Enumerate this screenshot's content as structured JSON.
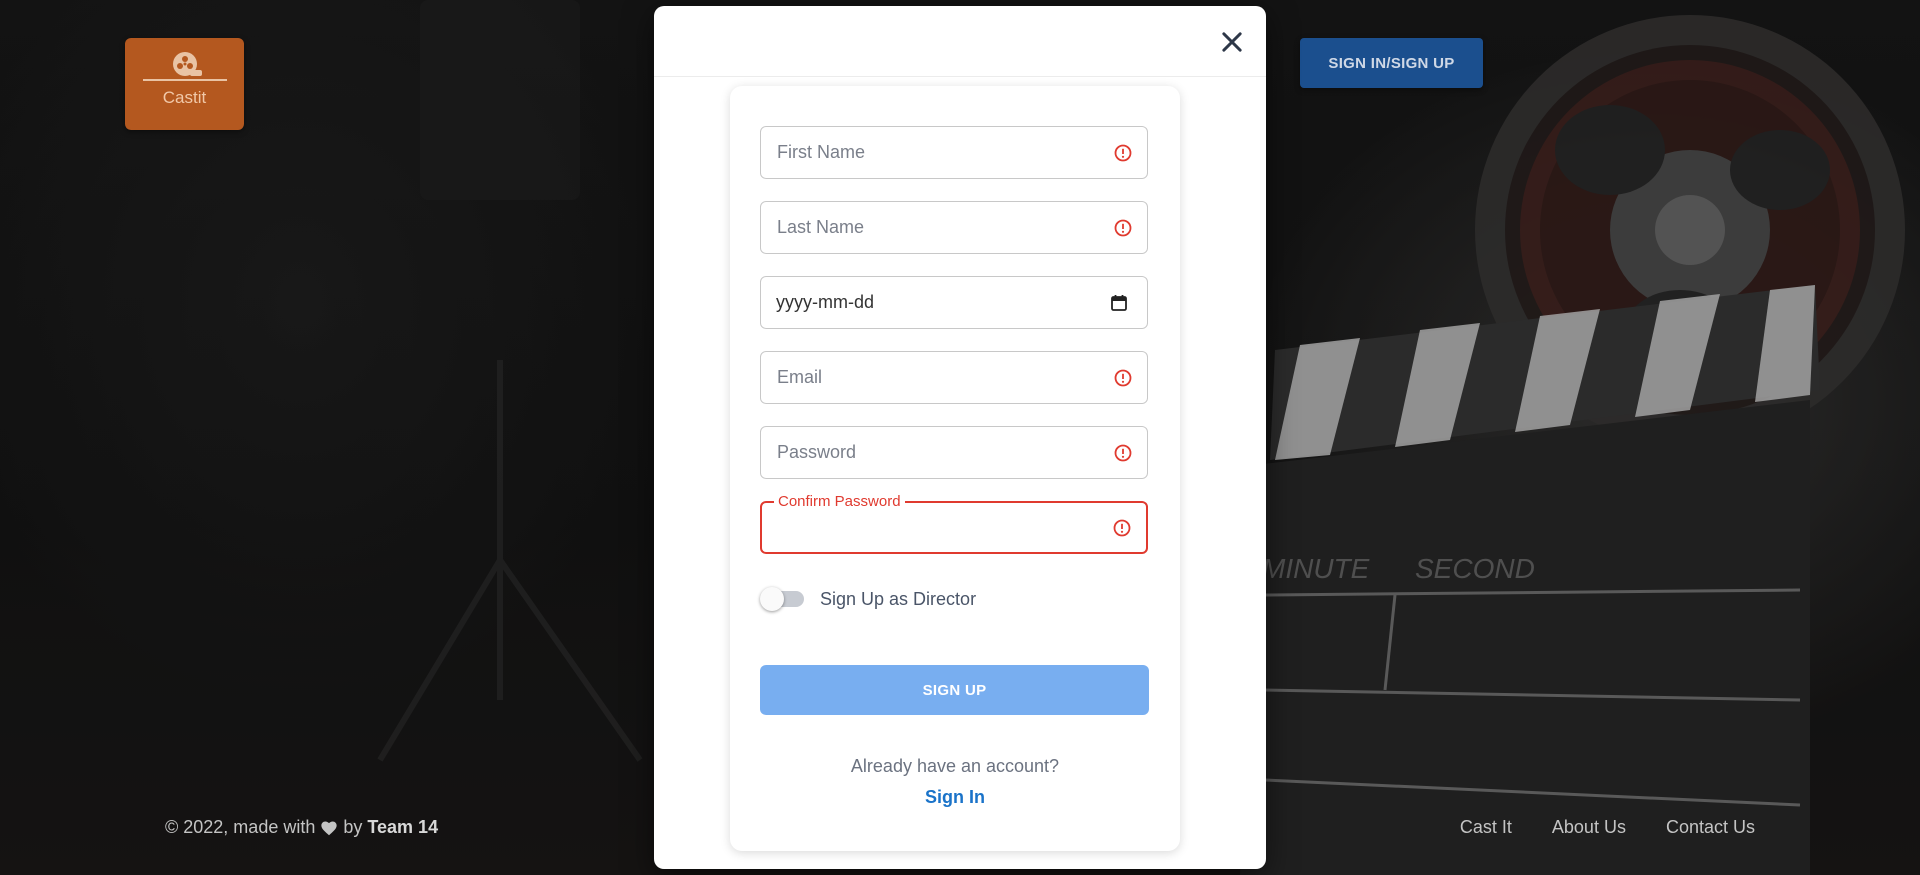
{
  "app": {
    "logo_text": "Castit",
    "signin_signup_label": "SIGN IN/SIGN UP"
  },
  "background": {
    "clapper_labels": [
      "MINUTE",
      "SECOND"
    ]
  },
  "footer": {
    "copyright_prefix": "© 2022, made with",
    "by_text": "by",
    "team": "Team 14",
    "links": [
      "Cast It",
      "About Us",
      "Contact Us"
    ]
  },
  "signup_form": {
    "fields": {
      "first_name": {
        "placeholder": "First Name",
        "value": ""
      },
      "last_name": {
        "placeholder": "Last Name",
        "value": ""
      },
      "dob": {
        "value": "yyyy-mm-dd"
      },
      "email": {
        "placeholder": "Email",
        "value": ""
      },
      "password": {
        "placeholder": "Password",
        "value": ""
      },
      "confirm_password": {
        "label": "Confirm Password",
        "value": ""
      }
    },
    "director_toggle": {
      "label": "Sign Up as Director",
      "checked": false
    },
    "submit_label": "SIGN UP",
    "account_prompt": "Already have an account?",
    "signin_link": "Sign In"
  },
  "colors": {
    "error": "#e03a2f",
    "primary_button": "#78aef0",
    "link": "#1a73c9",
    "logo_bg": "#b4581f",
    "header_button": "#1b4f8e"
  }
}
